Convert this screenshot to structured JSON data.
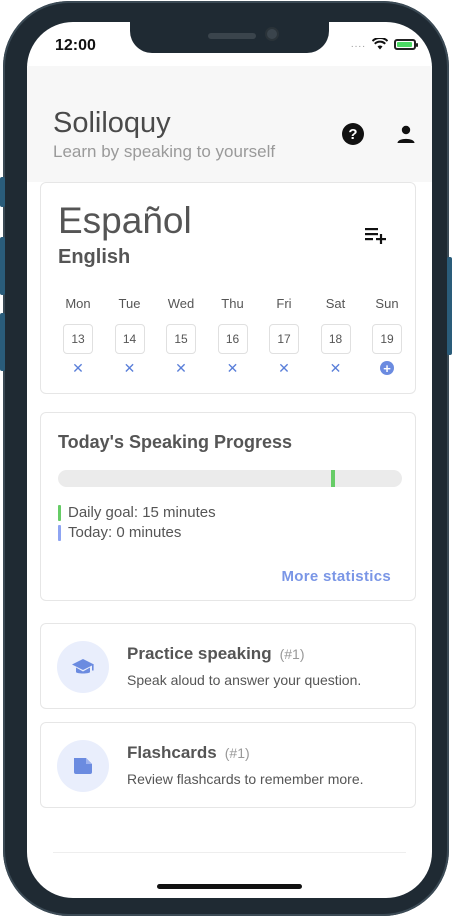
{
  "status_bar": {
    "time": "12:00",
    "signal": "....",
    "battery_level": 0.85
  },
  "header": {
    "title": "Soliloquy",
    "subtitle": "Learn by speaking to yourself",
    "help_icon": "help-circle-icon",
    "account_icon": "person-icon"
  },
  "language": {
    "target": "Español",
    "source": "English",
    "add_icon": "playlist-add-icon"
  },
  "week": [
    {
      "day": "Mon",
      "date": "13",
      "status": "missed"
    },
    {
      "day": "Tue",
      "date": "14",
      "status": "missed"
    },
    {
      "day": "Wed",
      "date": "15",
      "status": "missed"
    },
    {
      "day": "Thu",
      "date": "16",
      "status": "missed"
    },
    {
      "day": "Fri",
      "date": "17",
      "status": "missed"
    },
    {
      "day": "Sat",
      "date": "18",
      "status": "missed"
    },
    {
      "day": "Sun",
      "date": "19",
      "status": "today"
    }
  ],
  "progress": {
    "title": "Today's Speaking Progress",
    "daily_goal_label": "Daily goal: 15 minutes",
    "today_label": "Today: 0 minutes",
    "more_statistics": "More statistics",
    "today_fraction": 0,
    "goal_marker_fraction": 0.795,
    "goal_color": "#66cc66",
    "today_color": "#8ea4f2"
  },
  "activities": [
    {
      "title": "Practice speaking",
      "count": "(#1)",
      "description": "Speak aloud to answer your question.",
      "icon": "graduation-cap-icon"
    },
    {
      "title": "Flashcards",
      "count": "(#1)",
      "description": "Review flashcards to remember more.",
      "icon": "flashcard-icon"
    }
  ],
  "colors": {
    "accent": "#7a96e6",
    "icon_bg": "#e9eefc",
    "icon_fg": "#6b8be0"
  }
}
